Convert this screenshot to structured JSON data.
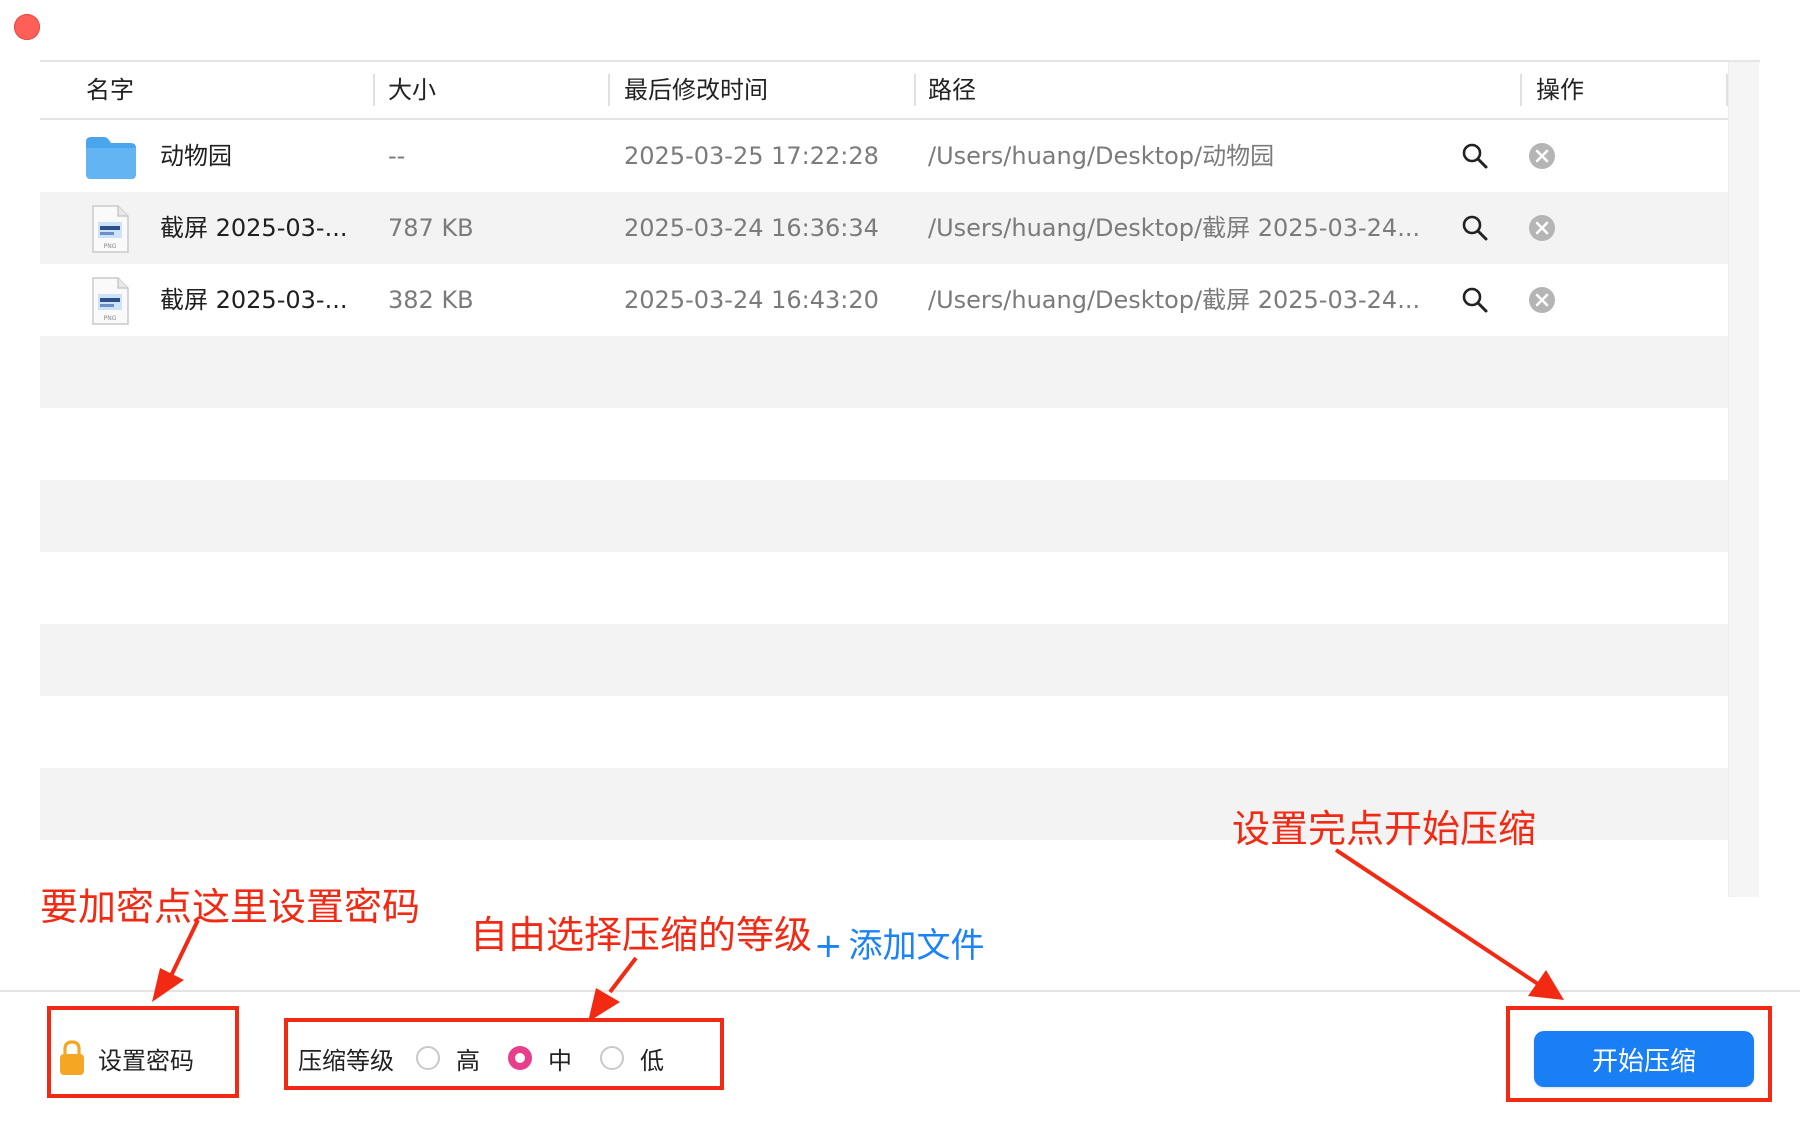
{
  "table": {
    "columns": [
      "名字",
      "大小",
      "最后修改时间",
      "路径",
      "操作"
    ],
    "rows": [
      {
        "icon": "folder-icon",
        "name": "动物园",
        "size": "--",
        "modified": "2025-03-25 17:22:28",
        "path": "/Users/huang/Desktop/动物园"
      },
      {
        "icon": "png-file-icon",
        "name": "截屏 2025-03-...",
        "size": "787 KB",
        "modified": "2025-03-24 16:36:34",
        "path": "/Users/huang/Desktop/截屏 2025-03-24..."
      },
      {
        "icon": "png-file-icon",
        "name": "截屏 2025-03-...",
        "size": "382 KB",
        "modified": "2025-03-24 16:43:20",
        "path": "/Users/huang/Desktop/截屏 2025-03-24..."
      }
    ]
  },
  "footer": {
    "add_files": "添加文件",
    "password_label": "设置密码",
    "level_label": "压缩等级",
    "levels": [
      "高",
      "中",
      "低"
    ],
    "selected_level": "中",
    "start_button": "开始压缩"
  },
  "annotations": {
    "password_hint": "要加密点这里设置密码",
    "level_hint": "自由选择压缩的等级",
    "start_hint": "设置完点开始压缩"
  },
  "colors": {
    "accent": "#1a7ff5",
    "annotation_red": "#f22a14",
    "radio_selected": "#e83e8c",
    "close_button": "#fe5f57"
  }
}
